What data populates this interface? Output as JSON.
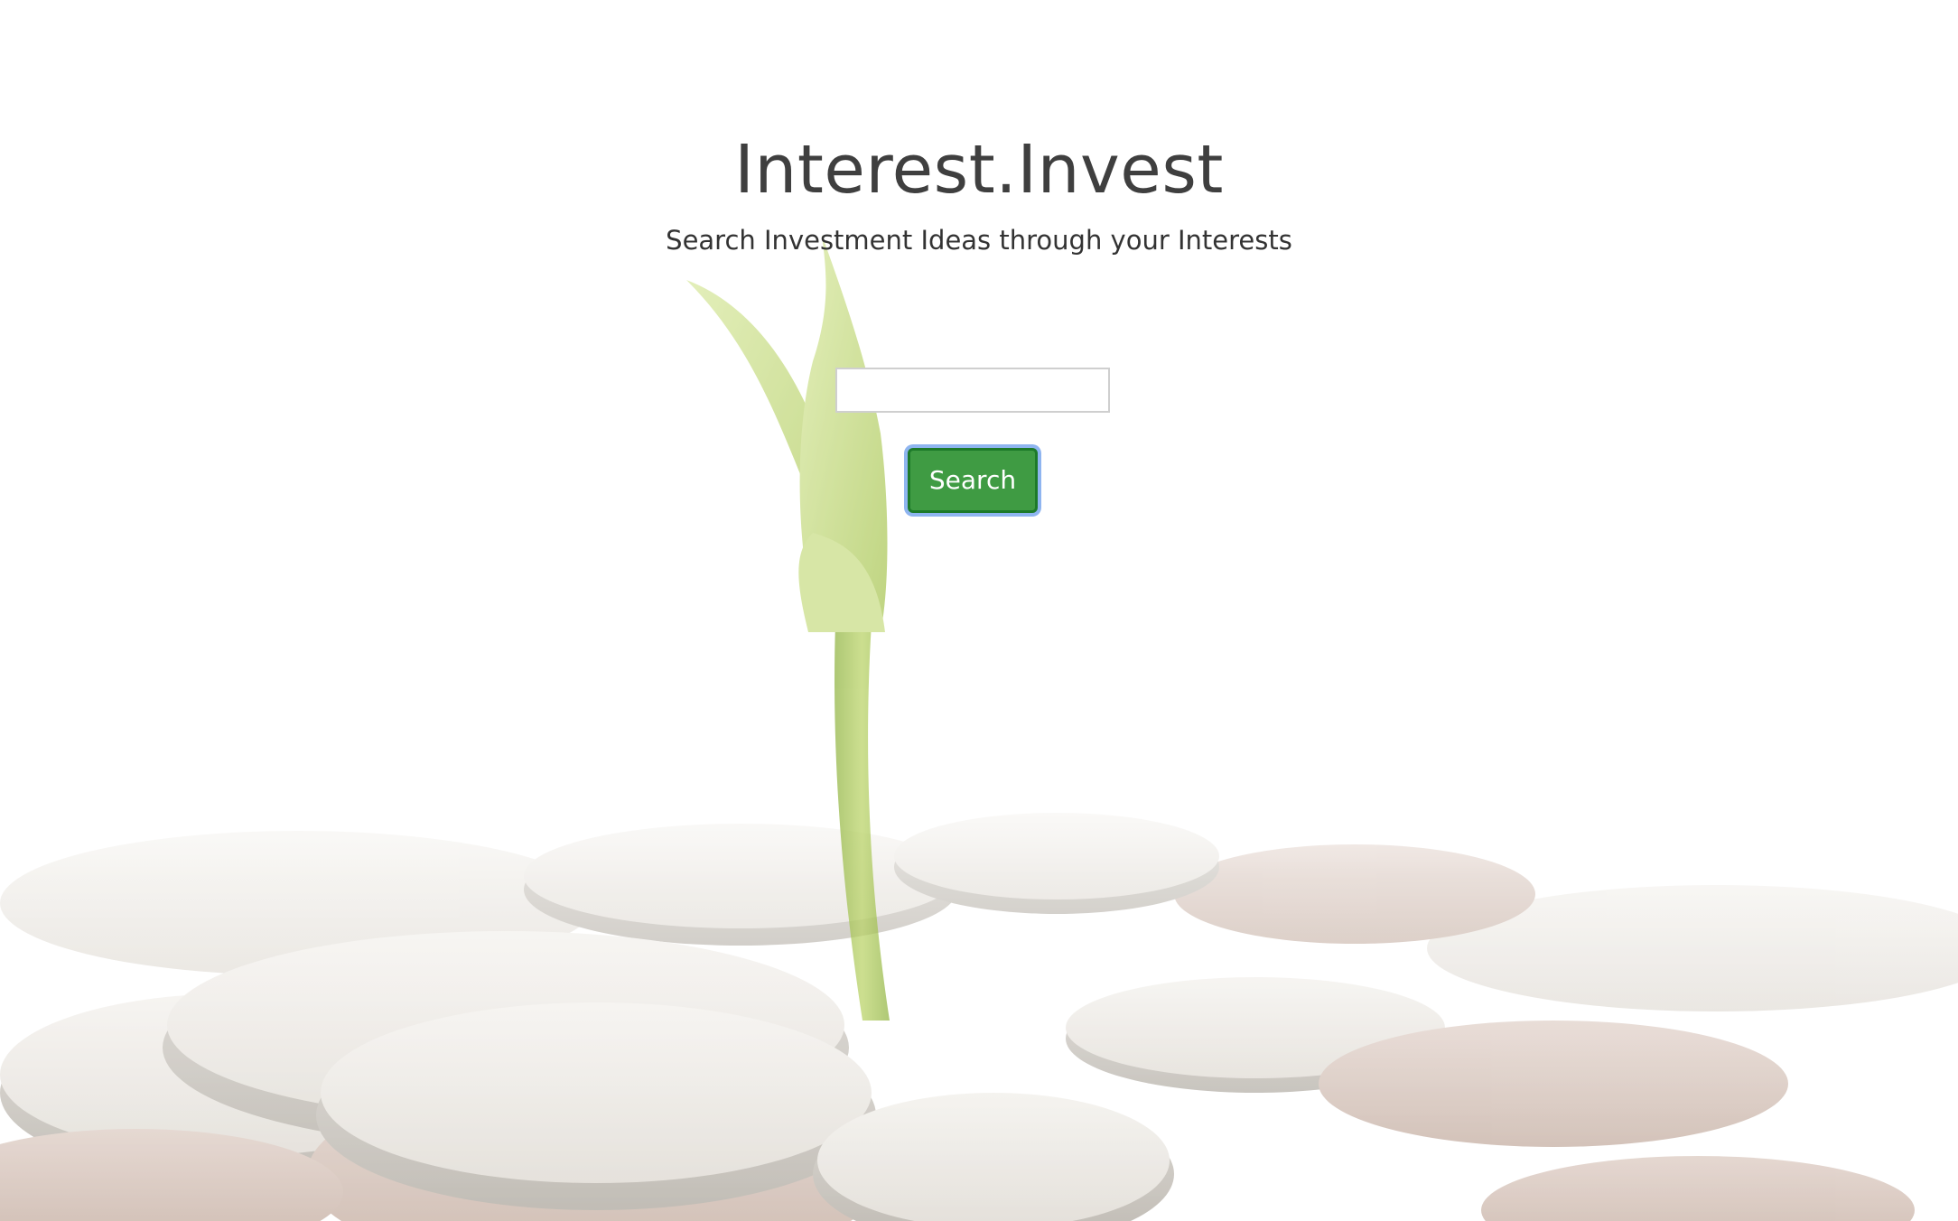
{
  "header": {
    "title": "Interest.Invest",
    "subtitle": "Search Investment Ideas through your Interests"
  },
  "search": {
    "value": "",
    "placeholder": "",
    "button_label": "Search"
  },
  "colors": {
    "button_bg": "#3f9b43",
    "button_border": "#1d7a2a",
    "focus_ring": "#8fb5f0",
    "title_text": "#3f3f3f",
    "sprout": "#a9c94f"
  }
}
